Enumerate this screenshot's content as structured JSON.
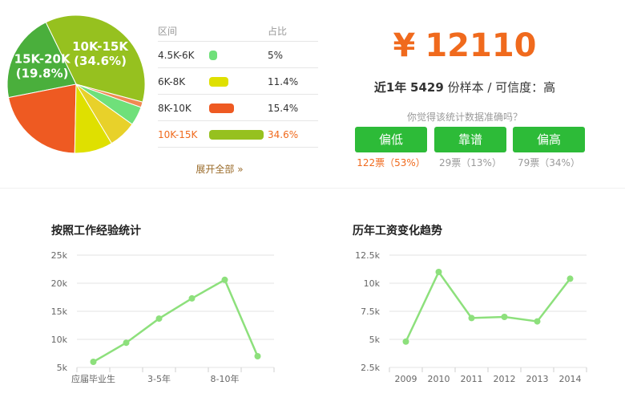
{
  "pie": {
    "slices": [
      {
        "category": "10K-15K",
        "percent": 34.6,
        "color": "#96c11f",
        "label_lines": [
          "10K-15K",
          "(34.6%)"
        ]
      },
      {
        "category": "15K-20K",
        "percent": 19.8,
        "color": "#4aaf3c",
        "label_lines": [
          "15K-20K",
          "(19.8%)"
        ]
      },
      {
        "category": "",
        "percent": 20.5,
        "color": "#ee5a22",
        "label_lines": []
      },
      {
        "category": "",
        "percent": 8.5,
        "color": "#dfe000",
        "label_lines": []
      },
      {
        "category": "8K-10K",
        "percent": 6.2,
        "color": "#e8d12a",
        "label_lines": []
      },
      {
        "category": "6K-8K",
        "percent": 4.2,
        "color": "#6fe07a",
        "label_lines": []
      },
      {
        "category": "4.5K-6K",
        "percent": 1.2,
        "color": "#f08a52",
        "label_lines": []
      }
    ]
  },
  "table": {
    "header": {
      "range": "区间",
      "ratio": "占比"
    },
    "rows": [
      {
        "range": "4.5K-6K",
        "ratio": "5%",
        "color": "#6fe07a",
        "fraction": 0.08
      },
      {
        "range": "6K-8K",
        "ratio": "11.4%",
        "color": "#dfe000",
        "fraction": 0.35
      },
      {
        "range": "8K-10K",
        "ratio": "15.4%",
        "color": "#ee5a22",
        "fraction": 0.45
      },
      {
        "range": "10K-15K",
        "ratio": "34.6%",
        "color": "#96c11f",
        "fraction": 1.0
      }
    ],
    "expand_label": "展开全部 »"
  },
  "summary": {
    "currency": "¥",
    "amount": "12110",
    "prefix": "近1年",
    "samples": "5429",
    "suffix": "份样本 / 可信度：高",
    "question": "你觉得该统计数据准确吗？",
    "votes": [
      {
        "label": "偏低",
        "count": "122票（53%）"
      },
      {
        "label": "靠谱",
        "count": "29票（13%）"
      },
      {
        "label": "偏高",
        "count": "79票（34%）"
      }
    ]
  },
  "chart_data": [
    {
      "type": "line",
      "title": "按照工作经验统计",
      "color": "#8de07c",
      "ylim": [
        5,
        25
      ],
      "yticks": [
        5,
        10,
        15,
        20,
        25
      ],
      "ytick_labels": [
        "5k",
        "10k",
        "15k",
        "20k",
        "25k"
      ],
      "values": [
        6,
        9.4,
        13.7,
        17.3,
        20.6,
        7
      ],
      "xtick_labels": [
        "应届毕业生",
        "",
        "3-5年",
        "",
        "8-10年",
        ""
      ]
    },
    {
      "type": "line",
      "title": "历年工资变化趋势",
      "color": "#8de07c",
      "ylim": [
        2.5,
        12.5
      ],
      "yticks": [
        2.5,
        5,
        7.5,
        10,
        12.5
      ],
      "ytick_labels": [
        "2.5k",
        "5k",
        "7.5k",
        "10k",
        "12.5k"
      ],
      "categories": [
        "2009",
        "2010",
        "2011",
        "2012",
        "2013",
        "2014"
      ],
      "values": [
        4.8,
        11,
        6.9,
        7,
        6.6,
        10.4
      ]
    }
  ]
}
